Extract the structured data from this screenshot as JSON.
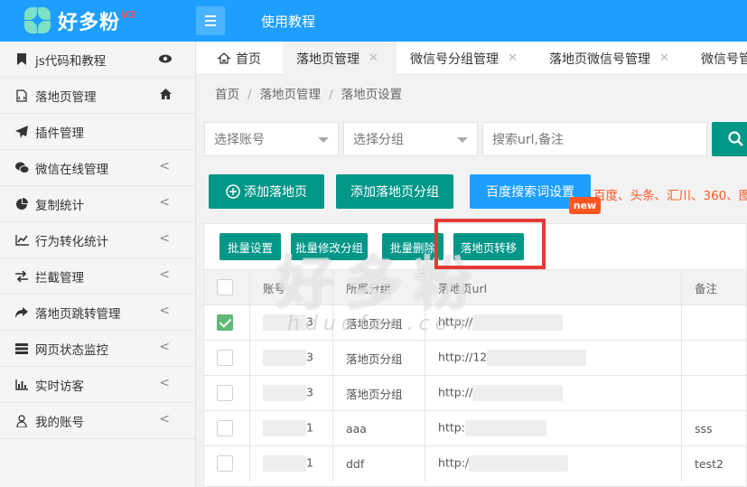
{
  "app": {
    "logo_text": "好多粉",
    "logo_version": "V3",
    "top_link": "使用教程"
  },
  "sidebar": {
    "items": [
      {
        "label": "js代码和教程",
        "icon": "bookmark-icon",
        "right_icon": "eye-icon"
      },
      {
        "label": "落地页管理",
        "icon": "file-code-icon",
        "right_icon": "home-icon"
      },
      {
        "label": "插件管理",
        "icon": "paper-plane-icon"
      },
      {
        "label": "微信在线管理",
        "icon": "wechat-icon",
        "arrow": "<"
      },
      {
        "label": "复制统计",
        "icon": "pie-chart-icon",
        "arrow": "<"
      },
      {
        "label": "行为转化统计",
        "icon": "line-chart-icon",
        "arrow": "<"
      },
      {
        "label": "拦截管理",
        "icon": "exchange-icon",
        "arrow": "<"
      },
      {
        "label": "落地页跳转管理",
        "icon": "share-icon",
        "arrow": "<"
      },
      {
        "label": "网页状态监控",
        "icon": "server-icon",
        "arrow": "<"
      },
      {
        "label": "实时访客",
        "icon": "bar-chart-icon",
        "arrow": "<"
      },
      {
        "label": "我的账号",
        "icon": "user-icon",
        "arrow": "<"
      }
    ]
  },
  "tabs": [
    {
      "label": "首页",
      "icon": "home-icon"
    },
    {
      "label": "落地页管理",
      "close": "✕"
    },
    {
      "label": "微信号分组管理",
      "close": "✕"
    },
    {
      "label": "落地页微信号管理",
      "close": "✕"
    },
    {
      "label": "微信号管"
    }
  ],
  "breadcrumb": {
    "items": [
      "首页",
      "落地页管理",
      "落地页设置"
    ],
    "sep": "/"
  },
  "filters": {
    "account_placeholder": "选择账号",
    "group_placeholder": "选择分组",
    "search_placeholder": "搜索url,备注"
  },
  "actions": {
    "add_page": "添加落地页",
    "add_group": "添加落地页分组",
    "baidu_keywords": "百度搜索词设置",
    "new_badge": "new",
    "promo": "百度、头条、汇川、360、图"
  },
  "batch": {
    "settings": "批量设置",
    "modify_group": "批量修改分组",
    "delete": "批量删除",
    "transfer": "落地页转移"
  },
  "watermark": {
    "main": "好多粉",
    "domain": "hduofen.com"
  },
  "table": {
    "headers": [
      "账号",
      "所属分组",
      "落地页url",
      "备注"
    ],
    "rows": [
      {
        "checked": true,
        "account": "3",
        "group": "落地页分组",
        "url": "http://",
        "note": ""
      },
      {
        "checked": false,
        "account": "3",
        "group": "落地页分组",
        "url": "http://12",
        "note": ""
      },
      {
        "checked": false,
        "account": "3",
        "group": "落地页分组",
        "url": "http://",
        "note": ""
      },
      {
        "checked": false,
        "account": "1",
        "group": "aaa",
        "url": "http:",
        "note": "sss"
      },
      {
        "checked": false,
        "account": "1",
        "group": "ddf",
        "url": "http:/",
        "note": "test2"
      }
    ]
  },
  "colors": {
    "primary": "#1e9fff",
    "green": "#009688",
    "highlight": "#e53935",
    "orange": "#ff5722"
  }
}
